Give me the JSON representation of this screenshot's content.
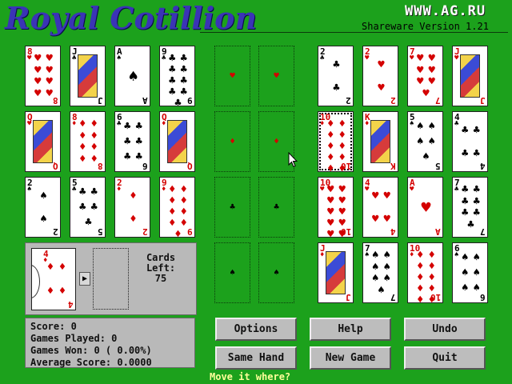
{
  "header": {
    "title": "Royal Cotillion",
    "url": "WWW.AG.RU",
    "version": "Shareware Version 1.21"
  },
  "colors": {
    "felt": "#1ca11c",
    "title": "#3a34b6",
    "red": "#d40000",
    "black": "#000000",
    "status": "#ffff9a"
  },
  "left_tableau": [
    [
      {
        "rank": "8",
        "suit": "♥"
      },
      {
        "rank": "J",
        "suit": "♣"
      },
      {
        "rank": "A",
        "suit": "♠"
      },
      {
        "rank": "9",
        "suit": "♣"
      }
    ],
    [
      {
        "rank": "Q",
        "suit": "♥"
      },
      {
        "rank": "8",
        "suit": "♦"
      },
      {
        "rank": "6",
        "suit": "♣"
      },
      {
        "rank": "Q",
        "suit": "♦"
      }
    ],
    [
      {
        "rank": "2",
        "suit": "♠"
      },
      {
        "rank": "5",
        "suit": "♣"
      },
      {
        "rank": "2",
        "suit": "♦"
      },
      {
        "rank": "9",
        "suit": "♦"
      }
    ]
  ],
  "foundation_slots": [
    [
      "♥",
      "♥"
    ],
    [
      "♦",
      "♦"
    ],
    [
      "♣",
      "♣"
    ],
    [
      "♠",
      "♠"
    ]
  ],
  "right_tableau": [
    [
      {
        "rank": "2",
        "suit": "♣"
      },
      {
        "rank": "2",
        "suit": "♥"
      },
      {
        "rank": "7",
        "suit": "♥"
      },
      {
        "rank": "J",
        "suit": "♥"
      }
    ],
    [
      {
        "rank": "10",
        "suit": "♦",
        "selected": true
      },
      {
        "rank": "K",
        "suit": "♦"
      },
      {
        "rank": "5",
        "suit": "♠"
      },
      {
        "rank": "4",
        "suit": "♣"
      }
    ],
    [
      {
        "rank": "10",
        "suit": "♥"
      },
      {
        "rank": "4",
        "suit": "♥"
      },
      {
        "rank": "A",
        "suit": "♥"
      },
      {
        "rank": "7",
        "suit": "♣"
      }
    ],
    [
      {
        "rank": "J",
        "suit": "♦"
      },
      {
        "rank": "7",
        "suit": "♠"
      },
      {
        "rank": "10",
        "suit": "♦"
      },
      {
        "rank": "6",
        "suit": "♠"
      }
    ]
  ],
  "stock": {
    "card": {
      "rank": "4",
      "suit": "♦"
    },
    "arrow": "▶",
    "cards_left_label": "Cards",
    "cards_left_label2": "Left:",
    "cards_left_value": "75"
  },
  "stats": {
    "score": "Score: 0",
    "games_played": "Games Played: 0",
    "games_won": "Games Won: 0 ( 0.00%)",
    "average_score": "Average Score:   0.0000"
  },
  "buttons": {
    "options": "Options",
    "help": "Help",
    "undo": "Undo",
    "same_hand": "Same Hand",
    "new_game": "New Game",
    "quit": "Quit"
  },
  "status": "Move it where?"
}
